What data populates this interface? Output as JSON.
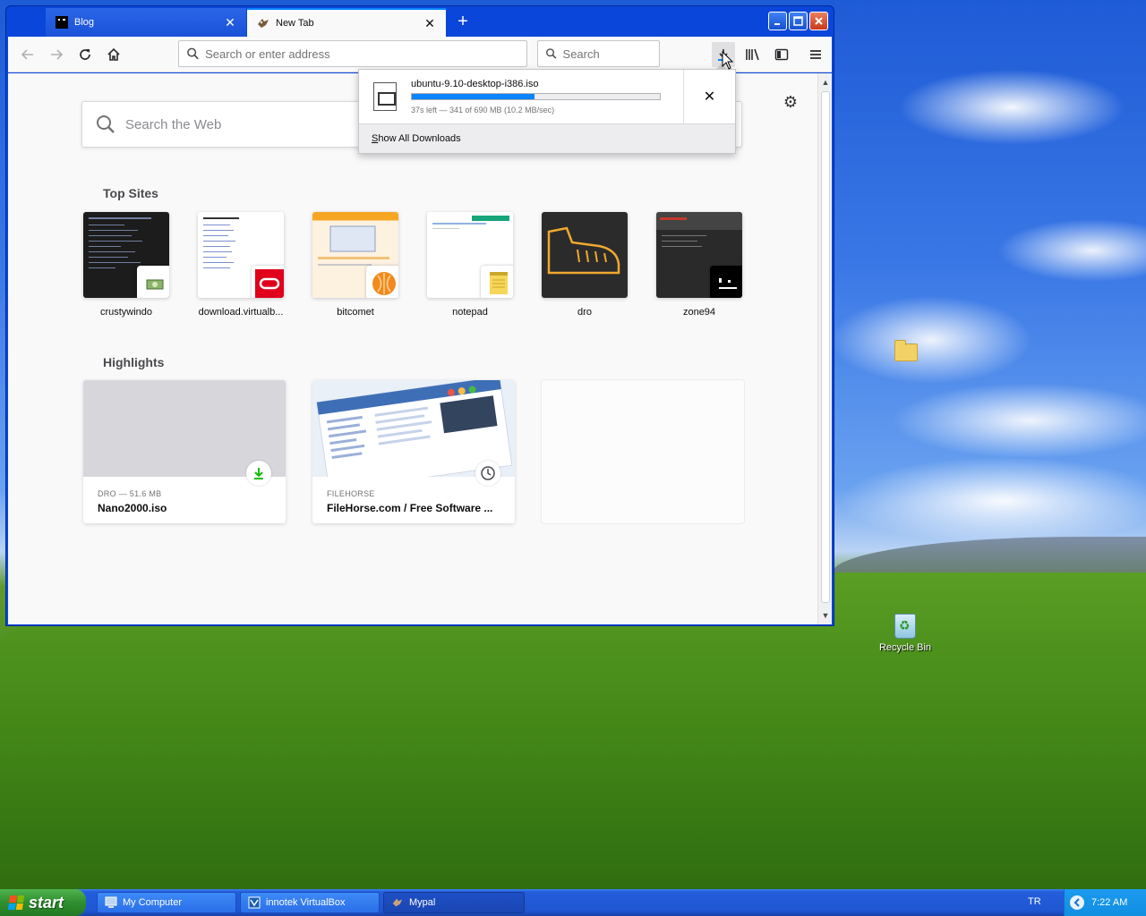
{
  "desktop": {
    "icons": [
      {
        "name": "Recycle Bin",
        "icon": "recycle-bin-icon"
      },
      {
        "name": "",
        "icon": "folder-icon"
      }
    ]
  },
  "browser": {
    "tabs": [
      {
        "title": "Blog",
        "icon": "blog-favicon",
        "active": false
      },
      {
        "title": "New Tab",
        "icon": "mypal-favicon",
        "active": true
      }
    ],
    "url_placeholder": "Search or enter address",
    "search_placeholder": "Search",
    "newtab": {
      "web_search_placeholder": "Search the Web",
      "top_sites_title": "Top Sites",
      "top_sites": [
        {
          "label": "crustywindo",
          "thumb_bg": "#1c1c1c",
          "badge": "money-icon"
        },
        {
          "label": "download.virtualb...",
          "thumb_bg": "#ffffff",
          "badge": "oracle-icon"
        },
        {
          "label": "bitcomet",
          "thumb_bg": "#f6a623",
          "badge": "bitcomet-icon"
        },
        {
          "label": "notepad",
          "thumb_bg": "#ffffff",
          "badge": "notepad-icon"
        },
        {
          "label": "dro",
          "thumb_bg": "#2b2b2b",
          "badge": "boot-icon"
        },
        {
          "label": "zone94",
          "thumb_bg": "#2a2a2a",
          "badge": "zone94-icon"
        }
      ],
      "highlights_title": "Highlights",
      "highlights": [
        {
          "context": "DRO — 51.6 MB",
          "title": "Nano2000.iso",
          "type_icon": "download-icon"
        },
        {
          "context": "FILEHORSE",
          "title": "FileHorse.com / Free Software ...",
          "type_icon": "history-clock-icon"
        }
      ]
    },
    "downloads_panel": {
      "filename": "ubuntu-9.10-desktop-i386.iso",
      "status": "37s left — 341 of 690 MB (10.2 MB/sec)",
      "progress_fraction": 0.494,
      "show_all_prefix": "S",
      "show_all_rest": "how All Downloads"
    }
  },
  "taskbar": {
    "start_label": "start",
    "buttons": [
      {
        "label": "My Computer",
        "icon": "my-computer-icon",
        "active": false
      },
      {
        "label": "innotek VirtualBox",
        "icon": "virtualbox-icon",
        "active": false
      },
      {
        "label": "Mypal",
        "icon": "mypal-icon",
        "active": true
      }
    ],
    "language": "TR",
    "clock": "7:22 AM"
  },
  "colors": {
    "accent": "#0a84ff",
    "download_green": "#12bc00",
    "xp_blue": "#245edb"
  }
}
